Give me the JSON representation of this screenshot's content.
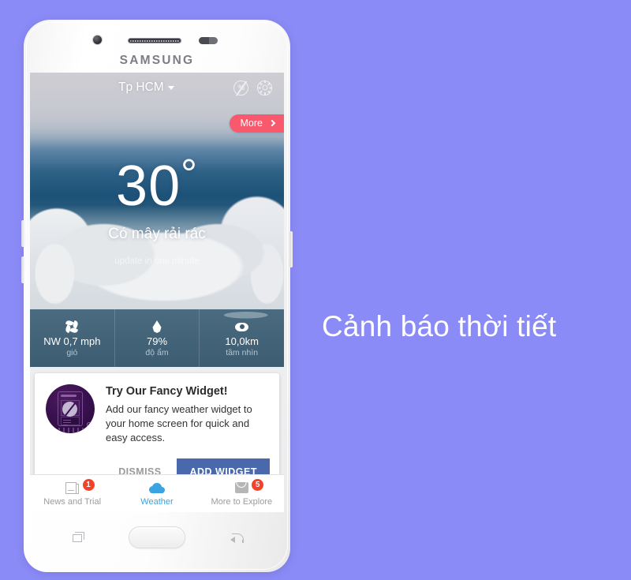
{
  "background_color": "#8b8bf7",
  "headline": "Cảnh báo thời tiết",
  "phone": {
    "brand": "SAMSUNG",
    "icons": {
      "front_camera": "front-camera-icon",
      "speaker": "earpiece-speaker",
      "sensor": "proximity-sensor",
      "home": "home-button",
      "recents": "recents-icon",
      "back": "back-icon",
      "volume_up": "volume-up-key",
      "volume_down": "volume-down-key",
      "power": "power-key"
    }
  },
  "app": {
    "header": {
      "city": "Tp HCM",
      "caret": "chevron-down-icon",
      "no_ads_icon": "no-percent-icon",
      "settings_icon": "gear-icon"
    },
    "more_button": {
      "label": "More",
      "chevron": "chevron-right-icon",
      "color": "#f8596c"
    },
    "current": {
      "temperature": "30",
      "degree": "°",
      "condition": "Có mây rải rác",
      "update_text": "update in one minute"
    },
    "metrics": [
      {
        "icon": "pinwheel-icon",
        "value": "NW 0,7 mph",
        "label": "gió"
      },
      {
        "icon": "water-drop-icon",
        "value": "79%",
        "label": "độ ẩm"
      },
      {
        "icon": "eye-icon",
        "value": "10,0km",
        "label": "tầm nhìn"
      }
    ],
    "promo_card": {
      "thumb_icon": "widget-illustration",
      "title": "Try Our Fancy Widget!",
      "description": "Add our fancy weather widget to your home screen for quick and easy access.",
      "dismiss_label": "DISMISS",
      "add_label": "ADD WIDGET",
      "add_color": "#4a69ac"
    },
    "tabs": [
      {
        "label": "News and Trial",
        "icon": "newspaper-icon",
        "badge": "1",
        "active": false
      },
      {
        "label": "Weather",
        "icon": "cloud-icon",
        "badge": "",
        "active": true
      },
      {
        "label": "More to Explore",
        "icon": "shopping-bag-icon",
        "badge": "5",
        "active": false
      }
    ],
    "accent_color": "#3ba3e0",
    "badge_color": "#f4412a"
  }
}
